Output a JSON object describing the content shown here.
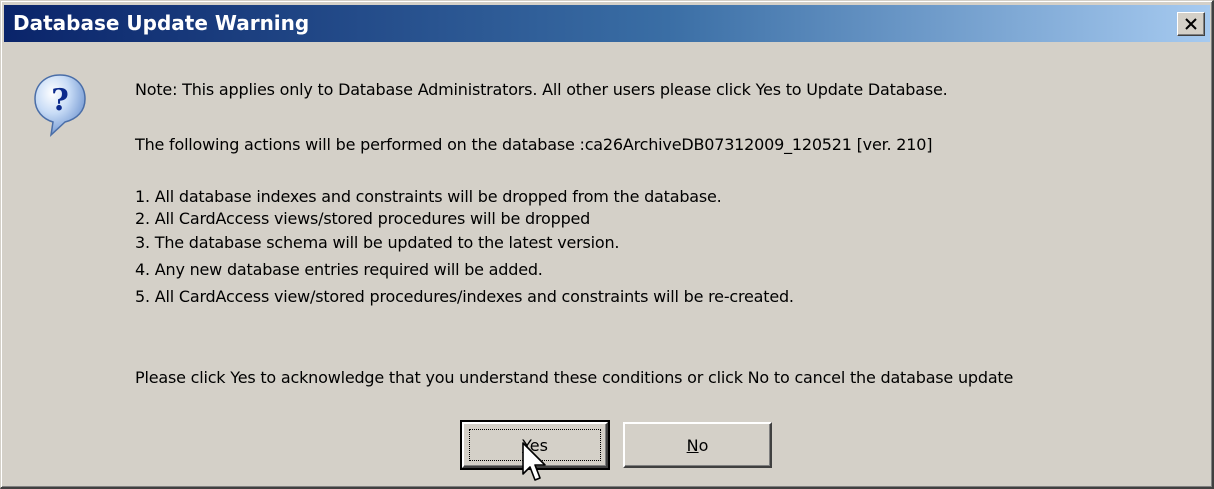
{
  "dialog": {
    "title": "Database Update Warning",
    "icon": "question-icon",
    "note": "Note: This applies only to Database Administrators. All other users please click Yes to Update Database.",
    "actions_intro": "The following actions will be performed on the database :ca26ArchiveDB07312009_120521 [ver. 210]",
    "actions": [
      "1. All database indexes and constraints will be dropped from the database.",
      "2. All CardAccess views/stored procedures will be dropped",
      "3. The database schema will be updated to the latest version.",
      "4. Any new database entries required will be added.",
      "5. All CardAccess view/stored procedures/indexes and constraints will be re-created."
    ],
    "prompt": "Please click Yes to acknowledge that you understand these conditions or click No to cancel the database update"
  },
  "buttons": {
    "yes": {
      "mnemonic": "Y",
      "rest": "es"
    },
    "no": {
      "mnemonic": "N",
      "rest": "o"
    }
  },
  "colors": {
    "titlebar_start": "#0a246a",
    "titlebar_end": "#a6caf0",
    "face": "#d4d0c8"
  }
}
